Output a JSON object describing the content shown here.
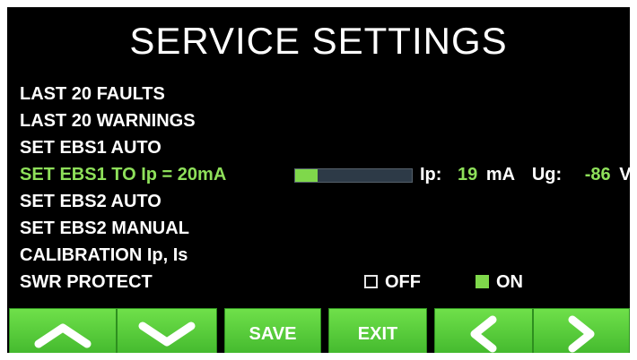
{
  "title": "SERVICE SETTINGS",
  "menu": {
    "items": [
      {
        "label": "LAST 20 FAULTS"
      },
      {
        "label": "LAST 20 WARNINGS"
      },
      {
        "label": "SET EBS1 AUTO"
      },
      {
        "label": "SET EBS1 TO Ip = 20mA"
      },
      {
        "label": "SET EBS2 AUTO"
      },
      {
        "label": "SET EBS2 MANUAL"
      },
      {
        "label": "CALIBRATION Ip, Is"
      },
      {
        "label": "SWR PROTECT"
      }
    ]
  },
  "ebs1": {
    "bar_fraction": 0.19,
    "ip_label": "Ip:",
    "ip_value": "19",
    "ip_unit": "mA",
    "ug_label": "Ug:",
    "ug_value": "-86",
    "ug_unit": "V"
  },
  "swr": {
    "off_label": "OFF",
    "on_label": "ON",
    "selected": "ON"
  },
  "buttons": {
    "save_label": "SAVE",
    "exit_label": "EXIT"
  },
  "colors": {
    "accent": "#8ee05a",
    "button": "#4fc636",
    "background": "#000000"
  }
}
